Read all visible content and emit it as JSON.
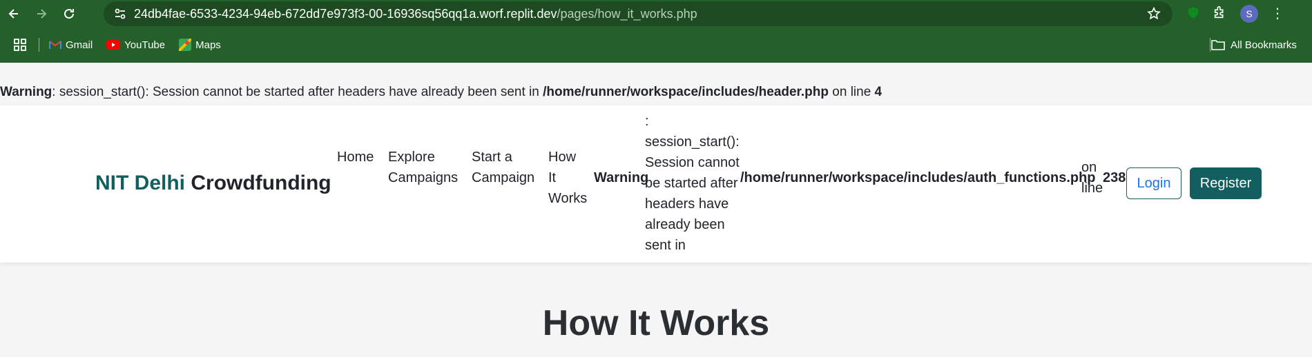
{
  "browser": {
    "url_host": "24db4fae-6533-4234-94eb-672dd7e973f3-00-16936sq56qq1a.worf.replit.dev",
    "url_path": "/pages/how_it_works.php",
    "profile_initial": "S",
    "bookmarks": [
      {
        "label": "Gmail",
        "icon": "gmail-icon"
      },
      {
        "label": "YouTube",
        "icon": "youtube-icon"
      },
      {
        "label": "Maps",
        "icon": "maps-icon"
      }
    ],
    "all_bookmarks": "All Bookmarks"
  },
  "warning_top": {
    "label": "Warning",
    "message": ": session_start(): Session cannot be started after headers have already been sent in ",
    "file": "/home/runner/workspace/includes/header.php",
    "line_text": " on line ",
    "line": "4"
  },
  "navbar": {
    "brand_part1": "NIT Delhi",
    "brand_part2": " Crowdfunding",
    "links": {
      "home": "Home",
      "explore_1": "Explore",
      "explore_2": "Campaigns",
      "start_1": "Start a",
      "start_2": "Campaign",
      "how_1": "How",
      "how_2": "It",
      "how_3": "Works"
    },
    "warning": {
      "label": "Warning",
      "message_lines": [
        ":",
        "session_start():",
        "Session cannot",
        "be started after",
        "headers have",
        "already been",
        "sent in"
      ],
      "file": "/home/runner/workspace/includes/auth_functions.php",
      "on": "on",
      "line_word": "line",
      "line": "238"
    },
    "login": "Login",
    "register": "Register"
  },
  "hero": {
    "title": "How It Works"
  },
  "colors": {
    "chrome": "#24602a",
    "brand_accent": "#135e5e",
    "login_text": "#1a73e8"
  }
}
